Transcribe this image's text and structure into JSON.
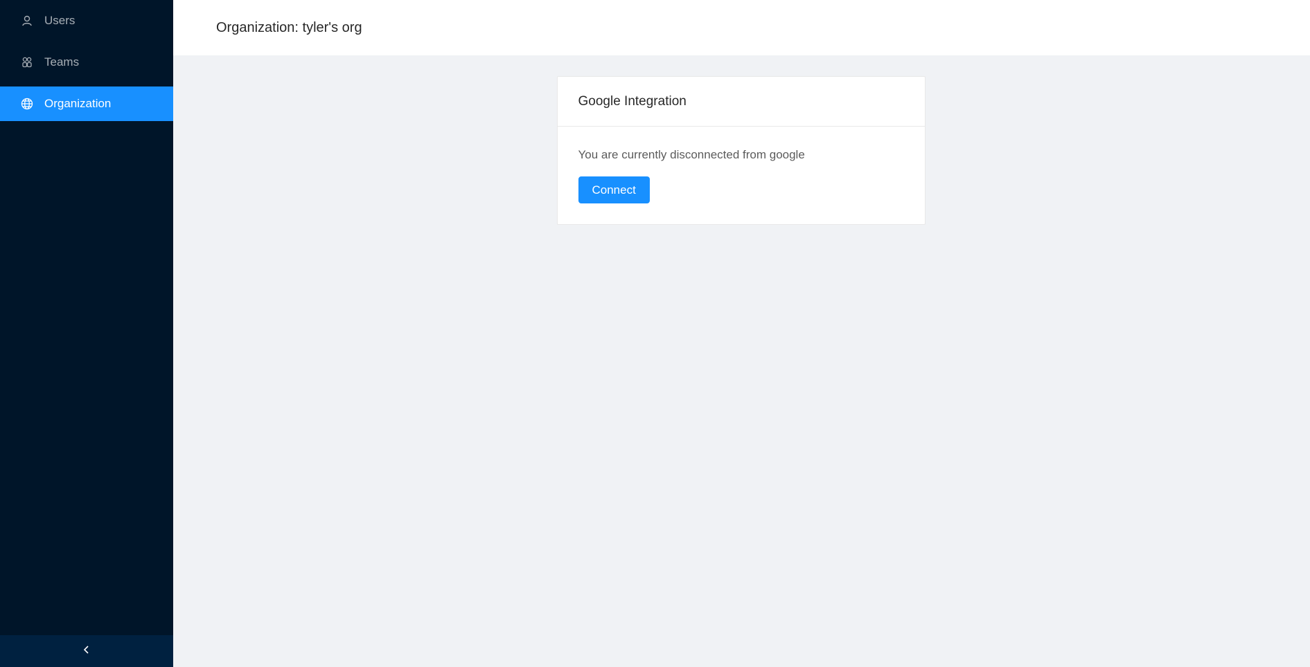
{
  "sidebar": {
    "items": [
      {
        "label": "Users",
        "icon": "user-icon",
        "active": false
      },
      {
        "label": "Teams",
        "icon": "team-icon",
        "active": false
      },
      {
        "label": "Organization",
        "icon": "globe-icon",
        "active": true
      }
    ],
    "collapse_icon": "chevron-left-icon"
  },
  "header": {
    "title": "Organization: tyler's org"
  },
  "card": {
    "title": "Google Integration",
    "status_text": "You are currently disconnected from google",
    "connect_label": "Connect"
  },
  "colors": {
    "sidebar_bg": "#001529",
    "collapse_bg": "#002140",
    "accent": "#1890ff",
    "content_bg": "#f0f2f5"
  }
}
